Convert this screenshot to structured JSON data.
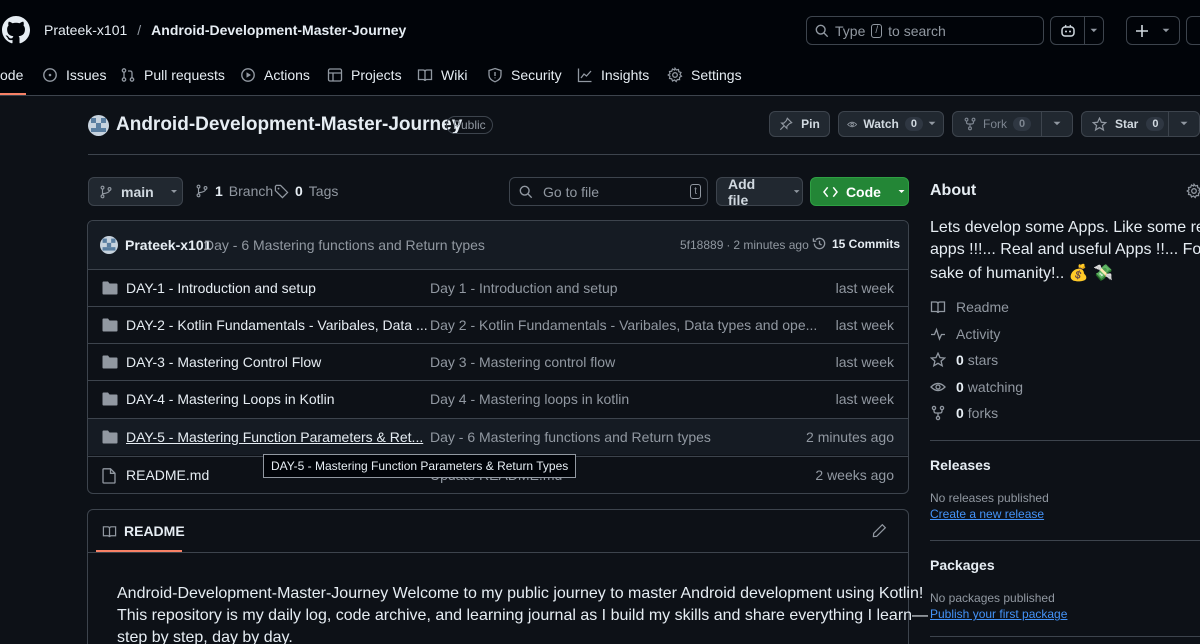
{
  "header": {
    "owner": "Prateek-x101",
    "slash": "/",
    "repo": "Android-Development-Master-Journey",
    "search_prefix": "Type",
    "search_key": "/",
    "search_suffix": "to search"
  },
  "tabs": [
    {
      "label": "ode",
      "icon": "code-icon"
    },
    {
      "label": "Issues",
      "icon": "issue-icon"
    },
    {
      "label": "Pull requests",
      "icon": "pull-request-icon"
    },
    {
      "label": "Actions",
      "icon": "play-icon"
    },
    {
      "label": "Projects",
      "icon": "table-icon"
    },
    {
      "label": "Wiki",
      "icon": "book-icon"
    },
    {
      "label": "Security",
      "icon": "shield-icon"
    },
    {
      "label": "Insights",
      "icon": "graph-icon"
    },
    {
      "label": "Settings",
      "icon": "gear-icon"
    }
  ],
  "repo": {
    "title": "Android-Development-Master-Journey",
    "visibility": "Public",
    "pin_label": "Pin",
    "watch_label": "Watch",
    "watch_count": "0",
    "fork_label": "Fork",
    "fork_count": "0",
    "star_label": "Star",
    "star_count": "0"
  },
  "toolbar": {
    "branch": "main",
    "branch_count": "1",
    "branch_label": "Branch",
    "tag_count": "0",
    "tag_label": "Tags",
    "goto_placeholder": "Go to file",
    "goto_key": "t",
    "add_file": "Add file",
    "code": "Code"
  },
  "commit": {
    "author": "Prateek-x101",
    "message": "Day - 6 Mastering functions and Return types",
    "hash": "5f18889",
    "dot": "·",
    "time": "2 minutes ago",
    "commits": "15 Commits"
  },
  "files": [
    {
      "name": "DAY-1 - Introduction and setup",
      "message": "Day 1 - Introduction and setup",
      "date": "last week",
      "type": "folder"
    },
    {
      "name": "DAY-2 - Kotlin Fundamentals - Varibales, Data ...",
      "message": "Day 2 - Kotlin Fundamentals - Varibales, Data types and ope...",
      "date": "last week",
      "type": "folder"
    },
    {
      "name": "DAY-3 - Mastering Control Flow",
      "message": "Day 3 - Mastering control flow",
      "date": "last week",
      "type": "folder"
    },
    {
      "name": "DAY-4 - Mastering Loops in Kotlin",
      "message": "Day 4 - Mastering loops in kotlin",
      "date": "last week",
      "type": "folder"
    },
    {
      "name": "DAY-5 - Mastering Function Parameters & Ret...",
      "message": "Day - 6 Mastering functions and Return types",
      "date": "2 minutes ago",
      "type": "folder"
    },
    {
      "name": "README.md",
      "message": "Update README.md",
      "date": "2 weeks ago",
      "type": "file"
    }
  ],
  "tooltip": "DAY-5 - Mastering Function Parameters & Return Types",
  "readme": {
    "tab": "README",
    "line1": "Android-Development-Master-Journey Welcome to my public journey to master Android development using Kotlin!",
    "line2": "This repository is my daily log, code archive, and learning journal as I build my skills and share everything I learn—",
    "line3": "step by step, day by day."
  },
  "about": {
    "title": "About",
    "desc1": "Lets develop some Apps. Like some real",
    "desc2": "apps !!!... Real and useful Apps !!... For the",
    "desc3": "sake of humanity!.. 💰 💸",
    "readme": "Readme",
    "activity": "Activity",
    "stars_count": "0",
    "stars": "stars",
    "watching_count": "0",
    "watching": "watching",
    "forks_count": "0",
    "forks": "forks"
  },
  "releases": {
    "title": "Releases",
    "none": "No releases published",
    "create": "Create a new release"
  },
  "packages": {
    "title": "Packages",
    "none": "No packages published",
    "publish": "Publish your first package"
  },
  "colors": {
    "bg": "#0d1117",
    "border": "#3d444d",
    "accent_green": "#238636",
    "link": "#4493f8",
    "tab_underline": "#f78166"
  }
}
